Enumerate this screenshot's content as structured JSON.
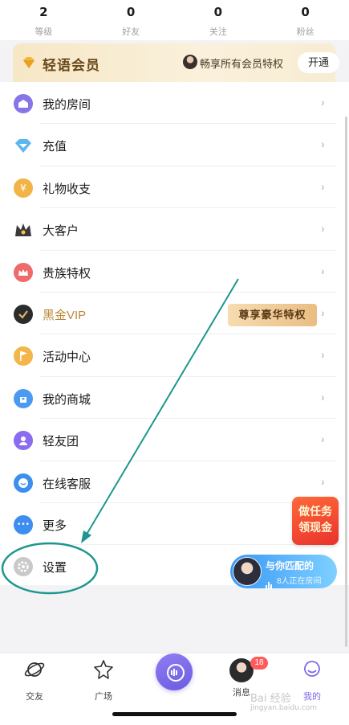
{
  "stats": [
    {
      "value": "2",
      "label": "等级"
    },
    {
      "value": "0",
      "label": "好友"
    },
    {
      "value": "0",
      "label": "关注"
    },
    {
      "value": "0",
      "label": "粉丝"
    }
  ],
  "vip": {
    "title": "轻语会员",
    "subtitle": "畅享所有会员特权",
    "button": "开通",
    "accent": "#f6e7c6"
  },
  "menu": [
    {
      "label": "我的房间",
      "icon": "house-icon"
    },
    {
      "label": "充值",
      "icon": "diamond-icon"
    },
    {
      "label": "礼物收支",
      "icon": "yen-coin-icon",
      "glyph": "¥"
    },
    {
      "label": "大客户",
      "icon": "crown-icon"
    },
    {
      "label": "贵族特权",
      "icon": "noble-crown-icon"
    },
    {
      "label": "黑金VIP",
      "icon": "check-badge-icon",
      "badge": "尊享豪华特权"
    },
    {
      "label": "活动中心",
      "icon": "flag-icon"
    },
    {
      "label": "我的商城",
      "icon": "shopping-bag-icon"
    },
    {
      "label": "轻友团",
      "icon": "person-icon"
    },
    {
      "label": "在线客服",
      "icon": "chat-bubble-icon"
    },
    {
      "label": "更多",
      "icon": "more-dots-icon",
      "glyph": "•••"
    },
    {
      "label": "设置",
      "icon": "gear-icon"
    }
  ],
  "chevron": "›",
  "task_card": {
    "line1": "做任务",
    "line2": "领现金"
  },
  "match_card": {
    "title": "与你匹配的",
    "subtitle": "8人正在房间"
  },
  "tabs": [
    {
      "label": "交友",
      "icon": "planet-icon"
    },
    {
      "label": "广场",
      "icon": "star-icon"
    },
    {
      "label": "",
      "icon": "mic-center-icon"
    },
    {
      "label": "消息",
      "icon": "avatar-icon",
      "badge": "18"
    },
    {
      "label": "我的",
      "icon": "profile-icon",
      "active": true
    }
  ],
  "watermark": {
    "line1": "Bai 经验",
    "line2": "jingyan.baidu.com"
  },
  "colors": {
    "annotation": "#1d968f",
    "active_tab": "#7c6be6",
    "badge": "#ff5b5b"
  }
}
